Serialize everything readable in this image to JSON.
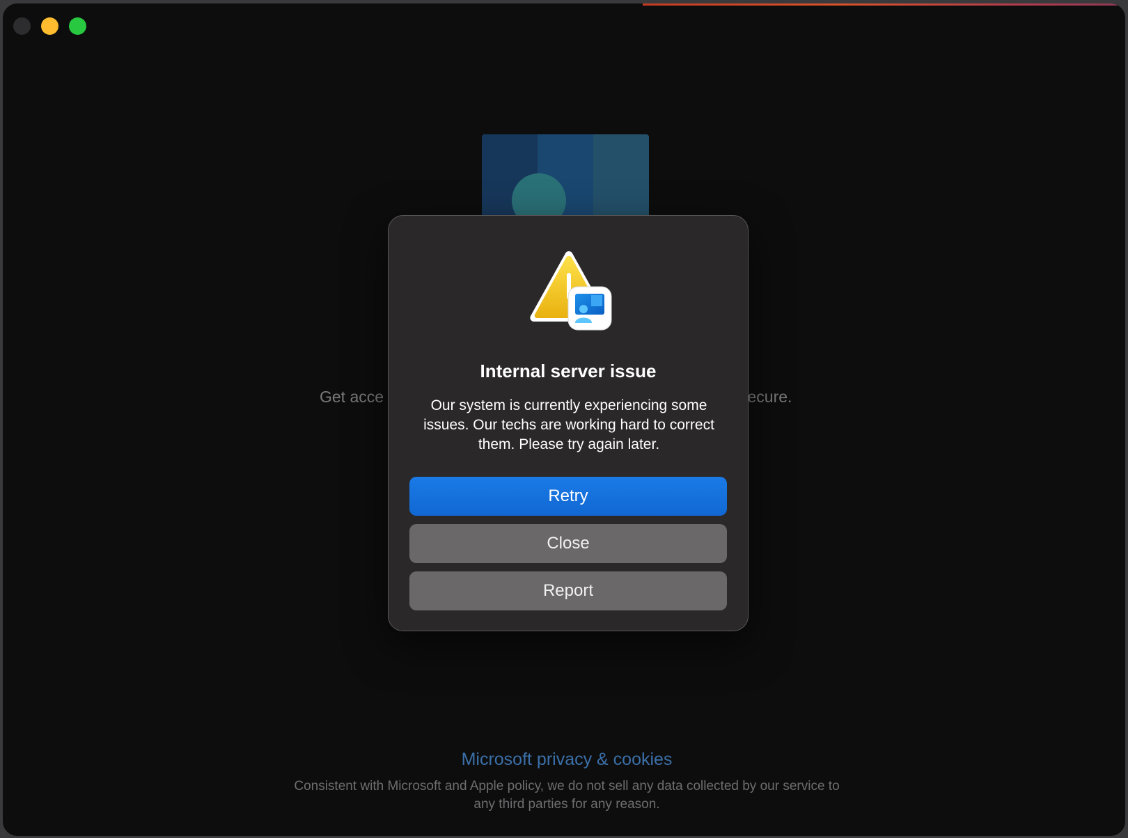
{
  "window": {
    "traffic_lights": [
      "close",
      "minimize",
      "zoom"
    ]
  },
  "background": {
    "line_left": "Get acce",
    "line_right": "secure.",
    "privacy_link": "Microsoft privacy & cookies",
    "privacy_note": "Consistent with Microsoft and Apple policy, we do not sell any data collected by our service to any third parties for any reason."
  },
  "dialog": {
    "icon": "warning-remote-desktop-icon",
    "title": "Internal server issue",
    "message": "Our system is currently experiencing some issues. Our techs are working hard to correct them. Please try again later.",
    "buttons": {
      "retry": "Retry",
      "close": "Close",
      "report": "Report"
    }
  },
  "colors": {
    "primary_button": "#1a7ae6",
    "secondary_button": "#6a6868",
    "warning": "#f5c518",
    "link": "#3b6fa8"
  }
}
